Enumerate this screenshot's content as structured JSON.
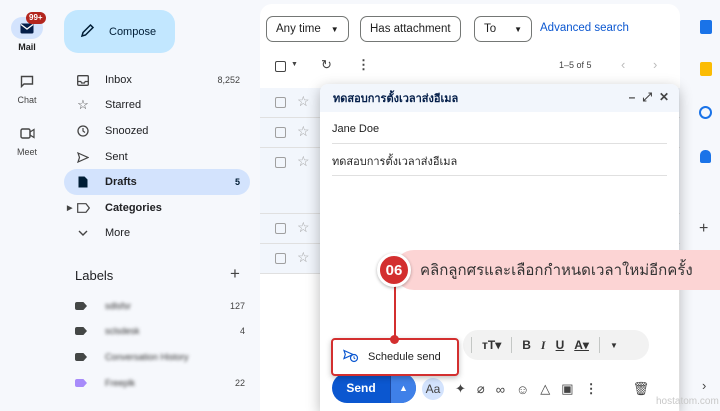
{
  "rail": {
    "mail_badge": "99+",
    "items": [
      {
        "label": "Mail",
        "icon": "mail-icon"
      },
      {
        "label": "Chat",
        "icon": "chat-icon"
      },
      {
        "label": "Meet",
        "icon": "meet-icon"
      }
    ]
  },
  "nav": {
    "compose_label": "Compose",
    "items": [
      {
        "label": "Inbox",
        "count": "8,252",
        "icon": "inbox-icon"
      },
      {
        "label": "Starred",
        "count": "",
        "icon": "star-icon"
      },
      {
        "label": "Snoozed",
        "count": "",
        "icon": "clock-icon"
      },
      {
        "label": "Sent",
        "count": "",
        "icon": "send-icon"
      },
      {
        "label": "Drafts",
        "count": "5",
        "icon": "draft-icon"
      },
      {
        "label": "Categories",
        "count": "",
        "icon": "label-icon"
      },
      {
        "label": "More",
        "count": "",
        "icon": "chevron-down-icon"
      }
    ],
    "labels_heading": "Labels",
    "labels": [
      {
        "name": "sdlsfsr",
        "count": "127",
        "color": "#444746"
      },
      {
        "name": "sclsdesk",
        "count": "4",
        "color": "#444746"
      },
      {
        "name": "Conversation History",
        "count": "",
        "color": "#444746"
      },
      {
        "name": "Freeplk",
        "count": "22",
        "color": "#a78bfa"
      }
    ]
  },
  "filters": {
    "any_time": "Any time",
    "has_attachment": "Has attachment",
    "to": "To",
    "advanced_search": "Advanced search"
  },
  "toolbar": {
    "page_info": "1–5 of 5"
  },
  "compose_dialog": {
    "title": "ทดสอบการตั้งเวลาส่งอีเมล",
    "to_value": "Jane Doe",
    "subject_value": "ทดสอบการตั้งเวลาส่งอีเมล",
    "send_label": "Send",
    "schedule_send_label": "Schedule send"
  },
  "annotation": {
    "step_number": "06",
    "text": "คลิกลูกศรและเลือกกำหนดเวลาใหม่อีกครั้ง"
  },
  "watermark": "hostatom.com",
  "colors": {
    "accent": "#0b57d0",
    "callout": "#d32f2f",
    "callout_bg": "#fcd4d4"
  }
}
